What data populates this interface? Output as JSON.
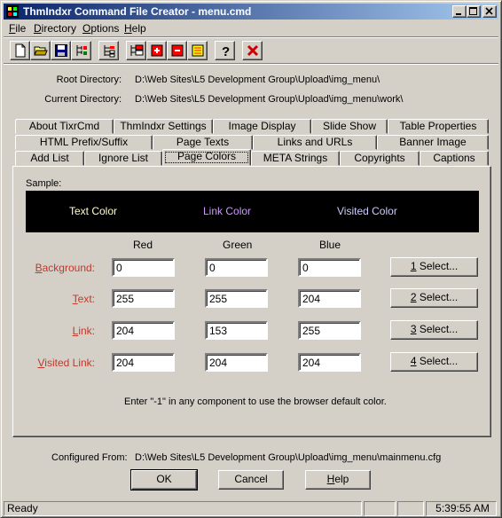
{
  "window": {
    "title": "ThmIndxr Command File Creator - menu.cmd",
    "controls": [
      "minimize-icon",
      "maximize-icon",
      "close-icon"
    ]
  },
  "menu": {
    "file_pre": "",
    "file_u": "F",
    "file_post": "ile",
    "directory_pre": "",
    "directory_u": "D",
    "directory_post": "irectory",
    "options_pre": "",
    "options_u": "O",
    "options_post": "ptions",
    "help_pre": "",
    "help_u": "H",
    "help_post": "elp"
  },
  "toolbar": {
    "icons": [
      "new-file-icon",
      "open-folder-icon",
      "save-disk-icon",
      "tree-structure-icon",
      "tree-expand-icon",
      "tree-red-icon",
      "tree-red-add-icon",
      "tree-red-remove-icon",
      "tree-yellow-icon",
      "help-question-icon",
      "delete-x-icon"
    ]
  },
  "paths": {
    "root_label": "Root Directory:",
    "root_value": "D:\\Web Sites\\L5 Development Group\\Upload\\img_menu\\",
    "current_label": "Current Directory:",
    "current_value": "D:\\Web Sites\\L5 Development Group\\Upload\\img_menu\\work\\"
  },
  "tabs": {
    "row1": [
      "About TixrCmd",
      "ThmIndxr Settings",
      "Image Display",
      "Slide Show",
      "Table Properties"
    ],
    "row2": [
      "HTML Prefix/Suffix",
      "Page Texts",
      "Links and URLs",
      "Banner Image"
    ],
    "row3": [
      "Add List",
      "Ignore List",
      "Page Colors",
      "META Strings",
      "Copyrights",
      "Captions"
    ],
    "active": "Page Colors"
  },
  "page_colors": {
    "sample_label": "Sample:",
    "sample_text": "Text Color",
    "sample_link": "Link Color",
    "sample_visited": "Visited Color",
    "sample_colors": {
      "background": "#000000",
      "text": "#ffffcc",
      "link": "#cc99ff",
      "visited": "#ccccff"
    },
    "headers": {
      "red": "Red",
      "green": "Green",
      "blue": "Blue"
    },
    "rows": [
      {
        "label_u": "B",
        "label_rest": "ackground:",
        "red": "0",
        "green": "0",
        "blue": "0",
        "select_u": "1",
        "select_rest": " Select..."
      },
      {
        "label_u": "T",
        "label_rest": "ext:",
        "red": "255",
        "green": "255",
        "blue": "204",
        "select_u": "2",
        "select_rest": " Select..."
      },
      {
        "label_u": "L",
        "label_rest": "ink:",
        "red": "204",
        "green": "153",
        "blue": "255",
        "select_u": "3",
        "select_rest": " Select..."
      },
      {
        "label_u": "V",
        "label_rest": "isited Link:",
        "red": "204",
        "green": "204",
        "blue": "204",
        "select_u": "4",
        "select_rest": " Select..."
      }
    ],
    "hint": "Enter \"-1\" in any component to use the browser default color."
  },
  "footer": {
    "configured_label": "Configured From:",
    "configured_value": "D:\\Web Sites\\L5 Development Group\\Upload\\img_menu\\mainmenu.cfg",
    "ok": "OK",
    "cancel": "Cancel",
    "help_u": "H",
    "help_rest": "elp"
  },
  "status": {
    "text": "Ready",
    "time": "5:39:55 AM"
  }
}
